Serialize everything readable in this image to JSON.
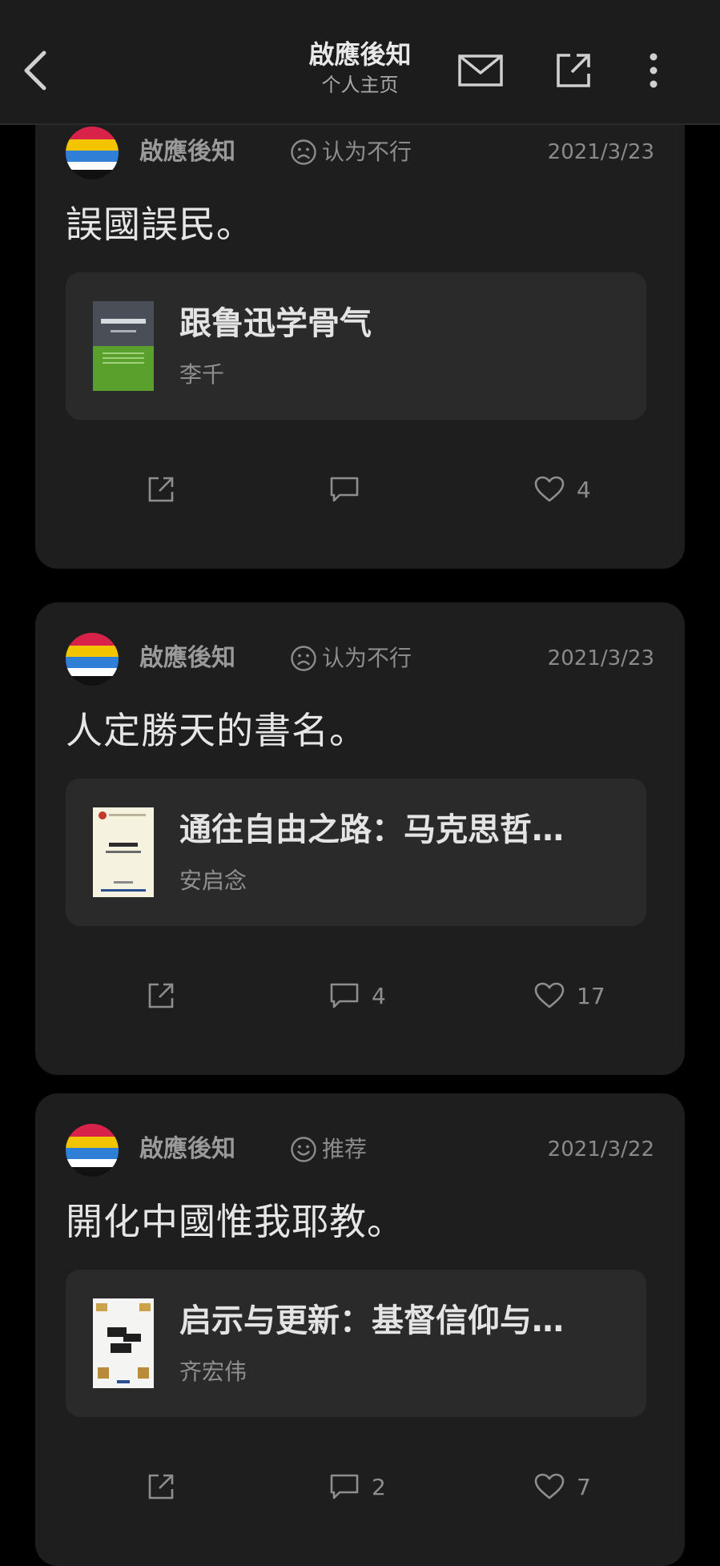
{
  "header": {
    "title": "啟應後知",
    "subtitle": "个人主页"
  },
  "posts": [
    {
      "username": "啟應後知",
      "mood": "认为不行",
      "mood_icon": "sad-face-icon",
      "date": "2021/3/23",
      "text": "誤國誤民。",
      "book": {
        "title": "跟鲁迅学骨气",
        "author": "李千",
        "cover_color": "#5aa02c"
      },
      "comments": "",
      "likes": "4"
    },
    {
      "username": "啟應後知",
      "mood": "认为不行",
      "mood_icon": "sad-face-icon",
      "date": "2021/3/23",
      "text": "人定勝天的書名。",
      "book": {
        "title": "通往自由之路：马克思哲…",
        "author": "安启念",
        "cover_color": "#f5f3df"
      },
      "comments": "4",
      "likes": "17"
    },
    {
      "username": "啟應後知",
      "mood": "推荐",
      "mood_icon": "smile-face-icon",
      "date": "2021/3/22",
      "text": "開化中國惟我耶教。",
      "book": {
        "title": "启示与更新：基督信仰与…",
        "author": "齐宏伟",
        "cover_color": "#f4f4f2"
      },
      "comments": "2",
      "likes": "7"
    }
  ],
  "colors": {
    "background": "#000000",
    "card": "#1e1e1f",
    "book_box": "#2a2a2b",
    "avatar_stripes": [
      "#d9224a",
      "#f2c500",
      "#2f7fd6",
      "#ffffff",
      "#111111"
    ]
  }
}
